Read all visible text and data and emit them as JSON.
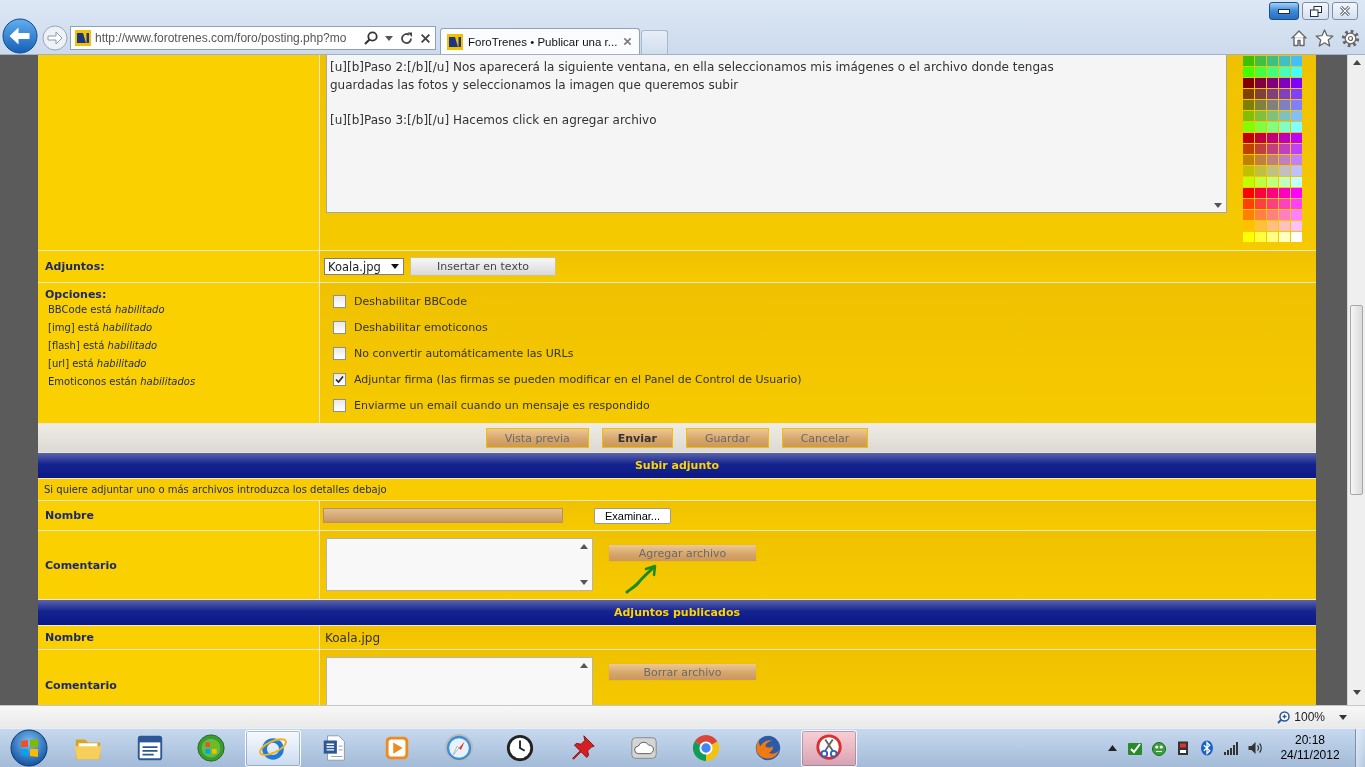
{
  "browser": {
    "minimize_highlighted": true,
    "url": "http://www.forotrenes.com/foro/posting.php?mo",
    "tabs": [
      {
        "title": "ForoTrenes • Publicar una r...",
        "selected": true
      }
    ],
    "zoom": "100%"
  },
  "message": {
    "value": "[u][b]Paso 2:[/b][/u] Nos aparecerá la siguiente ventana, en ella seleccionamos mis imágenes o el archivo donde tengas\nguardadas las fotos y seleccionamos la imagen que queremos subir\n\n[u][b]Paso 3:[/b][/u] Hacemos click en agregar archivo"
  },
  "color_palette": [
    {
      "color": "#40c000"
    },
    {
      "color": "#40c040"
    },
    {
      "color": "#40c080"
    },
    {
      "color": "#40c0c0"
    },
    {
      "color": "#40c0ff"
    },
    {
      "color": "#40ff00"
    },
    {
      "color": "#40ff40"
    },
    {
      "color": "#40ff80"
    },
    {
      "color": "#40ffc0"
    },
    {
      "color": "#40ffff"
    },
    {
      "color": "#800000"
    },
    {
      "color": "#800040"
    },
    {
      "color": "#800080"
    },
    {
      "color": "#8000c0"
    },
    {
      "color": "#8000ff"
    },
    {
      "color": "#804000"
    },
    {
      "color": "#804040"
    },
    {
      "color": "#804080"
    },
    {
      "color": "#8040c0"
    },
    {
      "color": "#8040ff"
    },
    {
      "color": "#808000"
    },
    {
      "color": "#808040"
    },
    {
      "color": "#808080"
    },
    {
      "color": "#8080c0"
    },
    {
      "color": "#8080ff"
    },
    {
      "color": "#80c000"
    },
    {
      "color": "#80c040"
    },
    {
      "color": "#80c080"
    },
    {
      "color": "#80c0c0"
    },
    {
      "color": "#80c0ff"
    },
    {
      "color": "#80ff00"
    },
    {
      "color": "#80ff40"
    },
    {
      "color": "#80ff80"
    },
    {
      "color": "#80ffc0"
    },
    {
      "color": "#80ffff"
    },
    {
      "color": "#c00000"
    },
    {
      "color": "#c00040"
    },
    {
      "color": "#c00080"
    },
    {
      "color": "#c000c0"
    },
    {
      "color": "#c000ff"
    },
    {
      "color": "#c04000"
    },
    {
      "color": "#c04040"
    },
    {
      "color": "#c04080"
    },
    {
      "color": "#c040c0"
    },
    {
      "color": "#c040ff"
    },
    {
      "color": "#c08000"
    },
    {
      "color": "#c08040"
    },
    {
      "color": "#c08080"
    },
    {
      "color": "#c080c0"
    },
    {
      "color": "#c080ff"
    },
    {
      "color": "#c0c000"
    },
    {
      "color": "#c0c040"
    },
    {
      "color": "#c0c080"
    },
    {
      "color": "#c0c0c0"
    },
    {
      "color": "#c0c0ff"
    },
    {
      "color": "#c0ff00"
    },
    {
      "color": "#c0ff40"
    },
    {
      "color": "#c0ff80"
    },
    {
      "color": "#c0ffc0"
    },
    {
      "color": "#c0ffff"
    },
    {
      "color": "#ff0000"
    },
    {
      "color": "#ff0040"
    },
    {
      "color": "#ff0080"
    },
    {
      "color": "#ff00c0"
    },
    {
      "color": "#ff00ff"
    },
    {
      "color": "#ff4000"
    },
    {
      "color": "#ff4040"
    },
    {
      "color": "#ff4080"
    },
    {
      "color": "#ff40c0"
    },
    {
      "color": "#ff40ff"
    },
    {
      "color": "#ff8000"
    },
    {
      "color": "#ff8040"
    },
    {
      "color": "#ff8080"
    },
    {
      "color": "#ff80c0"
    },
    {
      "color": "#ff80ff"
    },
    {
      "color": "#ffc000"
    },
    {
      "color": "#ffc040"
    },
    {
      "color": "#ffc080"
    },
    {
      "color": "#ffc0c0"
    },
    {
      "color": "#ffc0ff"
    },
    {
      "color": "#ffff00"
    },
    {
      "color": "#ffff40"
    },
    {
      "color": "#ffff80"
    },
    {
      "color": "#ffffc0"
    },
    {
      "color": "#ffffff"
    }
  ],
  "attachments": {
    "label": "Adjuntos:",
    "file": "Koala.jpg",
    "insert_button": "Insertar en texto"
  },
  "options": {
    "title": "Opciones:",
    "notes": [
      "BBCode está *habilitado*",
      "[img] está *habilitado*",
      "[flash] está *habilitado*",
      "[url] está *habilitado*",
      "Emoticonos están *habilitados*"
    ],
    "checkboxes": [
      {
        "label": "Deshabilitar BBCode",
        "checked": false
      },
      {
        "label": "Deshabilitar emoticonos",
        "checked": false
      },
      {
        "label": "No convertir automáticamente las URLs",
        "checked": false
      },
      {
        "label": "Adjuntar firma (las firmas se pueden modificar en el Panel de Control de Usuario)",
        "checked": true
      },
      {
        "label": "Enviarme un email cuando un mensaje es respondido",
        "checked": false
      }
    ]
  },
  "actions": [
    {
      "label": "Vista previa",
      "kind": "secondary"
    },
    {
      "label": "Enviar",
      "kind": "primary"
    },
    {
      "label": "Guardar",
      "kind": "secondary"
    },
    {
      "label": "Cancelar",
      "kind": "secondary"
    }
  ],
  "upload": {
    "title": "Subir adjunto",
    "hint": "Si quiere adjuntar uno o más archivos introduzca los detalles debajo",
    "name_label": "Nombre",
    "browse_button": "Examinar...",
    "comment_label": "Comentario",
    "add_button": "Agregar archivo"
  },
  "posted": {
    "title": "Adjuntos publicados",
    "name_label": "Nombre",
    "file_name": "Koala.jpg",
    "comment_label": "Comentario",
    "delete_button": "Borrar archivo"
  },
  "taskbar": {
    "apps": [
      {
        "running": false
      },
      {
        "running": false
      },
      {
        "running": false
      },
      {
        "running": true
      },
      {
        "running": false
      },
      {
        "running": false
      },
      {
        "running": false
      },
      {
        "running": false
      },
      {
        "running": false
      },
      {
        "running": false
      },
      {
        "running": false
      },
      {
        "running": false
      },
      {
        "running": true
      }
    ],
    "time": "20:18",
    "date": "24/11/2012"
  }
}
